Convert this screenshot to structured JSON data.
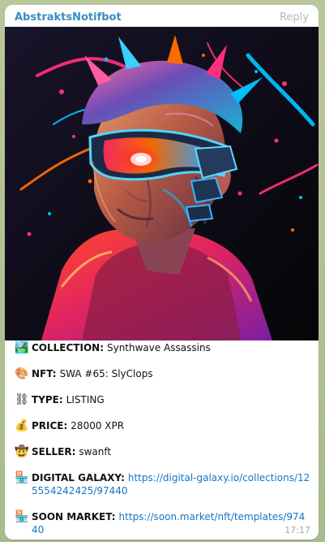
{
  "header": {
    "sender": "AbstraktsNotifbot",
    "reply_label": "Reply"
  },
  "message": {
    "collection": {
      "icon": "🏞️",
      "label": "COLLECTION:",
      "value": "Synthwave Assassins"
    },
    "nft": {
      "icon": "🎨",
      "label": "NFT:",
      "value": "SWA #65: SlyClops"
    },
    "type": {
      "icon": "⛓",
      "label": "TYPE:",
      "value": "LISTING"
    },
    "price": {
      "icon": "💰",
      "label": "PRICE:",
      "value": "28000 XPR"
    },
    "seller": {
      "icon": "🤠",
      "label": "SELLER:",
      "value": "swanft"
    },
    "digital_galaxy": {
      "icon": "🏪",
      "label": "DIGITAL GALAXY:",
      "link": "https://digital-galaxy.io/collections/125554242425/97440"
    },
    "soon_market": {
      "icon": "🏪",
      "label": "SOON MARKET:",
      "link": "https://soon.market/nft/templates/97440"
    }
  },
  "meta": {
    "time": "17:17"
  },
  "colors": {
    "sender": "#3a8dc0",
    "link": "#1976c2",
    "bubble": "#ffffff",
    "background": "#b5c39a"
  },
  "icons": {
    "collection": "landscape-icon",
    "nft": "palette-icon",
    "type": "chains-icon",
    "price": "money-bag-icon",
    "seller": "cowboy-face-icon",
    "market": "shop-icon"
  }
}
